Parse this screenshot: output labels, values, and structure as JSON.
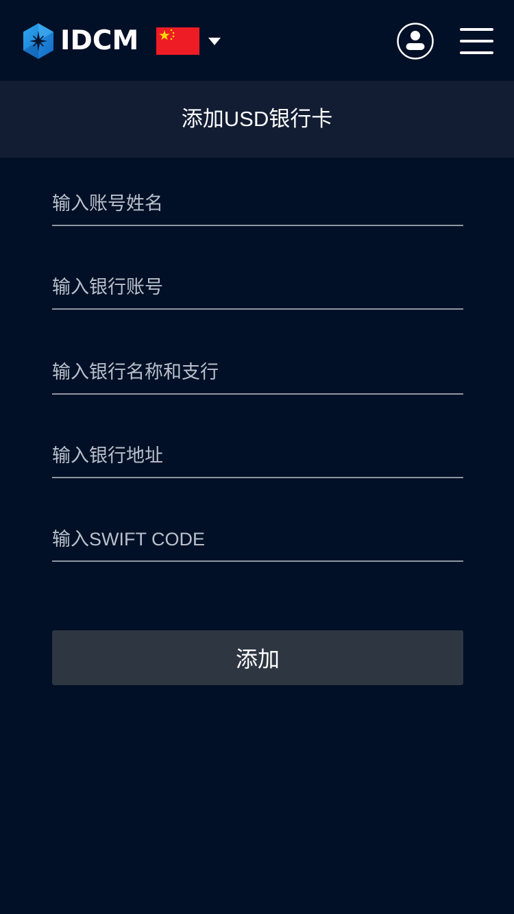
{
  "header": {
    "logo_text": "IDCM",
    "logo_icon": "hexagon-star-logo",
    "language_flag": "china-flag-icon",
    "language_caret": "caret-down-icon",
    "user_icon": "user-icon",
    "menu_icon": "hamburger-menu-icon"
  },
  "page": {
    "title": "添加USD银行卡"
  },
  "form": {
    "account_name_placeholder": "输入账号姓名",
    "bank_account_placeholder": "输入银行账号",
    "bank_name_branch_placeholder": "输入银行名称和支行",
    "bank_address_placeholder": "输入银行地址",
    "swift_code_placeholder": "输入SWIFT CODE",
    "submit_label": "添加"
  },
  "colors": {
    "background": "#011026",
    "header_band": "#121d33",
    "button": "#2e3642",
    "underline": "#8f97a3",
    "brand_blue": "#1a8cdc",
    "flag_red": "#ee1c25",
    "flag_yellow": "#ffde00"
  }
}
